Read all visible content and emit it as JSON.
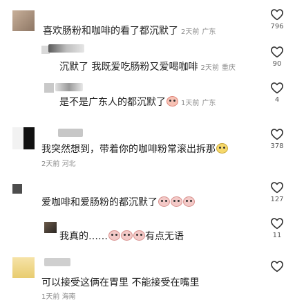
{
  "comments": [
    {
      "text": "喜欢肠粉和咖啡的看了都沉默了",
      "time": "2天前",
      "location": "广东",
      "likes": "796"
    },
    {
      "text": "沉默了 我既爱吃肠粉又爱喝咖啡",
      "time": "2天前",
      "location": "重庆",
      "likes": "90"
    },
    {
      "text": "是不是广东人的都沉默了",
      "time": "1天前",
      "location": "广东",
      "likes": "4"
    },
    {
      "text": "我突然想到，带着你的咖啡粉常滚出拆那",
      "time": "2天前",
      "location": "河北",
      "likes": "378"
    },
    {
      "text": "爱咖啡和爱肠粉的都沉默了",
      "time": "",
      "location": "",
      "likes": "127"
    },
    {
      "text": "我真的……",
      "text_after": "有点无语",
      "time": "",
      "location": "",
      "likes": "11"
    },
    {
      "text": "可以接受这俩在胃里 不能接受在嘴里",
      "time": "1天前",
      "location": "海南",
      "likes": ""
    }
  ],
  "icons": {
    "like": "heart-outline-icon",
    "reaction": "pig-face-emoji-icon"
  },
  "colors": {
    "text": "#1f1f1f",
    "meta": "#8a8a8a",
    "background": "#ffffff"
  }
}
